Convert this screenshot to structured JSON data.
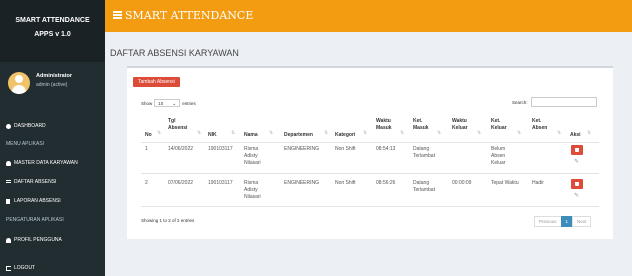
{
  "sidebar": {
    "app_name": "SMART ATTENDANCE",
    "app_version": "APPS v 1.0",
    "user_name": "Administrator",
    "user_status": "admin (active)",
    "items": [
      {
        "label": "DASHBOARD",
        "icon": "dashboard-icon"
      },
      {
        "label": "MENU APLIKASI",
        "header": true
      },
      {
        "label": "MASTER DATA KARYAWAN",
        "icon": "users-icon"
      },
      {
        "label": "DAFTAR ABSENSI",
        "icon": "list-icon"
      },
      {
        "label": "LAPORAN ABSENSI",
        "icon": "file-icon"
      },
      {
        "label": "PENGATURAN APLIKASI",
        "header": true
      },
      {
        "label": "PROFIL PENGGUNA",
        "icon": "user-icon"
      },
      {
        "label": "LOGOUT",
        "icon": "logout-icon"
      }
    ]
  },
  "header": {
    "title": "SMART ATTENDANCE"
  },
  "page": {
    "title": "DAFTAR ABSENSI KARYAWAN"
  },
  "toolbar": {
    "add_label": "Tambah Absensi",
    "show_label": "Show",
    "entries_value": "10",
    "entries_label": "entries",
    "search_label": "Search:"
  },
  "table": {
    "columns": [
      [
        "No"
      ],
      [
        "Tgl",
        "Absensi"
      ],
      [
        "NIK"
      ],
      [
        "Nama"
      ],
      [
        "Departemen"
      ],
      [
        "Kategori"
      ],
      [
        "Waktu",
        "Masuk"
      ],
      [
        "Ket.",
        "Masuk"
      ],
      [
        "Waktu",
        "Keluar"
      ],
      [
        "Ket.",
        "Keluar"
      ],
      [
        "Ket.",
        "Absen"
      ],
      [
        "Aksi"
      ]
    ],
    "rows": [
      {
        "no": "1",
        "tgl": "14/06/2022",
        "nik": "190103117",
        "nama": [
          "Risma",
          "Adisty",
          "Nilasari"
        ],
        "departemen": "ENGINEERING",
        "kategori": "Non Shift",
        "waktu_masuk": "08:54:13",
        "ket_masuk": [
          "Datang",
          "Terlambat"
        ],
        "waktu_keluar": "",
        "ket_keluar": [
          "Belum",
          "Absen",
          "Keluar"
        ],
        "ket_absen": ""
      },
      {
        "no": "2",
        "tgl": "07/06/2022",
        "nik": "190103117",
        "nama": [
          "Risma",
          "Adisty",
          "Nilasari"
        ],
        "departemen": "ENGINEERING",
        "kategori": "Non Shift",
        "waktu_masuk": "08:56:26",
        "ket_masuk": [
          "Datang",
          "Terlambat"
        ],
        "waktu_keluar": "00:00:09",
        "ket_keluar": [
          "Tepat Waktu"
        ],
        "ket_absen": "Hadir"
      }
    ]
  },
  "footer": {
    "info": "Showing 1 to 2 of 2 entries",
    "prev": "Previous",
    "page": "1",
    "next": "Next"
  },
  "colors": {
    "header": "#f39c12",
    "sidebar": "#222d32",
    "danger": "#dd4b39",
    "primary": "#3c8dbc"
  }
}
